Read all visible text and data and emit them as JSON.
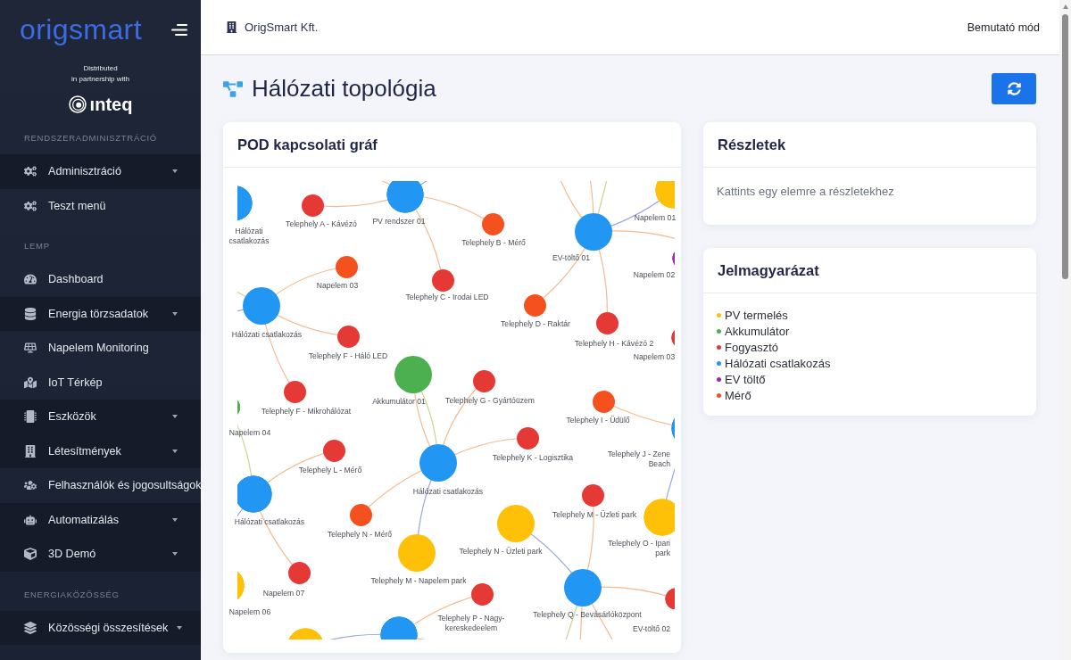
{
  "sidebar": {
    "logo": "origsmart",
    "partner_note": [
      "Distributed",
      "in partnership with"
    ],
    "partner_logo": "ınteq",
    "sections": [
      {
        "heading": "RENDSZERADMINISZTRÁCIÓ",
        "items": [
          {
            "label": "Adminisztráció",
            "has_submenu": true
          },
          {
            "label": "Teszt menü",
            "has_submenu": false
          }
        ]
      },
      {
        "heading": "LEMP",
        "items": [
          {
            "label": "Dashboard",
            "has_submenu": false
          },
          {
            "label": "Energia törzsadatok",
            "has_submenu": true
          },
          {
            "label": "Napelem Monitoring",
            "has_submenu": false
          },
          {
            "label": "IoT Térkép",
            "has_submenu": false
          },
          {
            "label": "Eszközök",
            "has_submenu": true
          },
          {
            "label": "Létesítmények",
            "has_submenu": true
          },
          {
            "label": "Felhasználók és jogosultságok",
            "has_submenu": false
          },
          {
            "label": "Automatizálás",
            "has_submenu": true
          },
          {
            "label": "3D Demó",
            "has_submenu": true
          }
        ]
      },
      {
        "heading": "ENERGIAKÖZÖSSÉG",
        "items": [
          {
            "label": "Közösségi összesítések",
            "has_submenu": true
          }
        ]
      }
    ]
  },
  "topbar": {
    "organization": "OrigSmart Kft.",
    "mode": "Bemutató mód"
  },
  "page": {
    "title": "Hálózati topológia"
  },
  "graph_card": {
    "title": "POD kapcsolati gráf",
    "nodes": [
      {
        "label": "Hálózati csatlakozás",
        "color": "#2196f3"
      },
      {
        "label": "Telephely A - Kávézó",
        "color": "#e53935"
      },
      {
        "label": "PV rendszer 01",
        "color": "#2196f3"
      },
      {
        "label": "Telephely B - Mérő",
        "color": "#f4511e"
      },
      {
        "label": "EV-töltő 01",
        "color": "#2196f3"
      },
      {
        "label": "Napelem 01",
        "color": "#ffc107"
      },
      {
        "label": "Napelem 03",
        "color": "#f4511e"
      },
      {
        "label": "Telephely C - Irodai LED",
        "color": "#e53935"
      },
      {
        "label": "Napelem 02",
        "color": "#9c27b0"
      },
      {
        "label": "Hálózati csatlakozás",
        "color": "#2196f3"
      },
      {
        "label": "Telephely D - Raktár",
        "color": "#f4511e"
      },
      {
        "label": "Telephely H - Kávézó 2",
        "color": "#e53935"
      },
      {
        "label": "Napelem 03",
        "color": "#e53935"
      },
      {
        "label": "Telephely F - Háló LED",
        "color": "#e53935"
      },
      {
        "label": "Akkumulátor 01",
        "color": "#4caf50"
      },
      {
        "label": "Telephely G - Gyártóüzem",
        "color": "#e53935"
      },
      {
        "label": "Telephely F - Mikrohálózat",
        "color": "#e53935"
      },
      {
        "label": "Telephely I - Üdülő",
        "color": "#f4511e"
      },
      {
        "label": "Napelem 04",
        "color": "#4caf50"
      },
      {
        "label": "Telephely J - Zene Beach",
        "color": "#2196f3"
      },
      {
        "label": "Telephely L - Mérő",
        "color": "#e53935"
      },
      {
        "label": "Telephely K - Logisztika",
        "color": "#e53935"
      },
      {
        "label": "Hálózati csatlakozás",
        "color": "#2196f3"
      },
      {
        "label": "Hálózati csatlakozás",
        "color": "#2196f3"
      },
      {
        "label": "Telephely M - Üzleti park",
        "color": "#e53935"
      },
      {
        "label": "Telephely N - Mérő",
        "color": "#f4511e"
      },
      {
        "label": "Telephely N - Üzleti park",
        "color": "#ffc107"
      },
      {
        "label": "Telephely O - Ipari park",
        "color": "#ffc107"
      },
      {
        "label": "Telephely M - Napelem park",
        "color": "#ffc107"
      },
      {
        "label": "Napelem 07",
        "color": "#e53935"
      },
      {
        "label": "Napelem 06",
        "color": "#ffc107"
      },
      {
        "label": "Telephely Q - Bevásárlóközpont",
        "color": "#2196f3"
      },
      {
        "label": "Telephely P - Nagy-kereskedeelem",
        "color": "#e53935"
      },
      {
        "label": "EV-töltő 02",
        "color": "#e53935"
      },
      {
        "color": "#ffc107"
      },
      {
        "color": "#2196f3"
      }
    ]
  },
  "details_card": {
    "title": "Részletek",
    "hint": "Kattints egy elemre a részletekhez"
  },
  "legend_card": {
    "title": "Jelmagyarázat",
    "items": [
      {
        "label": "PV termelés",
        "color": "#ffc107"
      },
      {
        "label": "Akkumulátor",
        "color": "#4caf50"
      },
      {
        "label": "Fogyasztó",
        "color": "#e53935"
      },
      {
        "label": "Hálózati csatlakozás",
        "color": "#2196f3"
      },
      {
        "label": "EV töltő",
        "color": "#9c27b0"
      },
      {
        "label": "Mérő",
        "color": "#f4511e"
      }
    ]
  }
}
